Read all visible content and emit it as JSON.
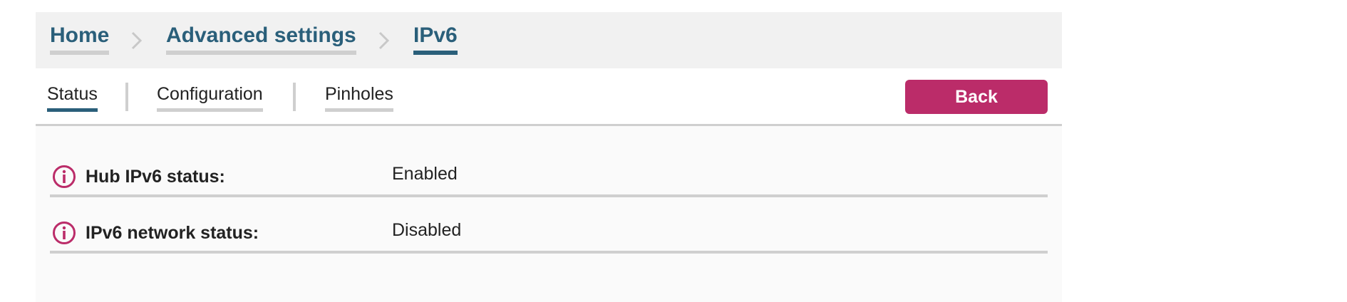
{
  "breadcrumb": {
    "items": [
      {
        "label": "Home"
      },
      {
        "label": "Advanced settings"
      },
      {
        "label": "IPv6"
      }
    ]
  },
  "tabs": [
    {
      "label": "Status",
      "active": true
    },
    {
      "label": "Configuration",
      "active": false
    },
    {
      "label": "Pinholes",
      "active": false
    }
  ],
  "actions": {
    "back_label": "Back"
  },
  "status_rows": [
    {
      "label": "Hub IPv6 status:",
      "value": "Enabled",
      "icon": "info-icon"
    },
    {
      "label": "IPv6 network status:",
      "value": "Disabled",
      "icon": "info-icon"
    }
  ],
  "colors": {
    "accent": "#bb2c69",
    "link": "#2a5f7a",
    "divider": "#cfcfcf"
  }
}
